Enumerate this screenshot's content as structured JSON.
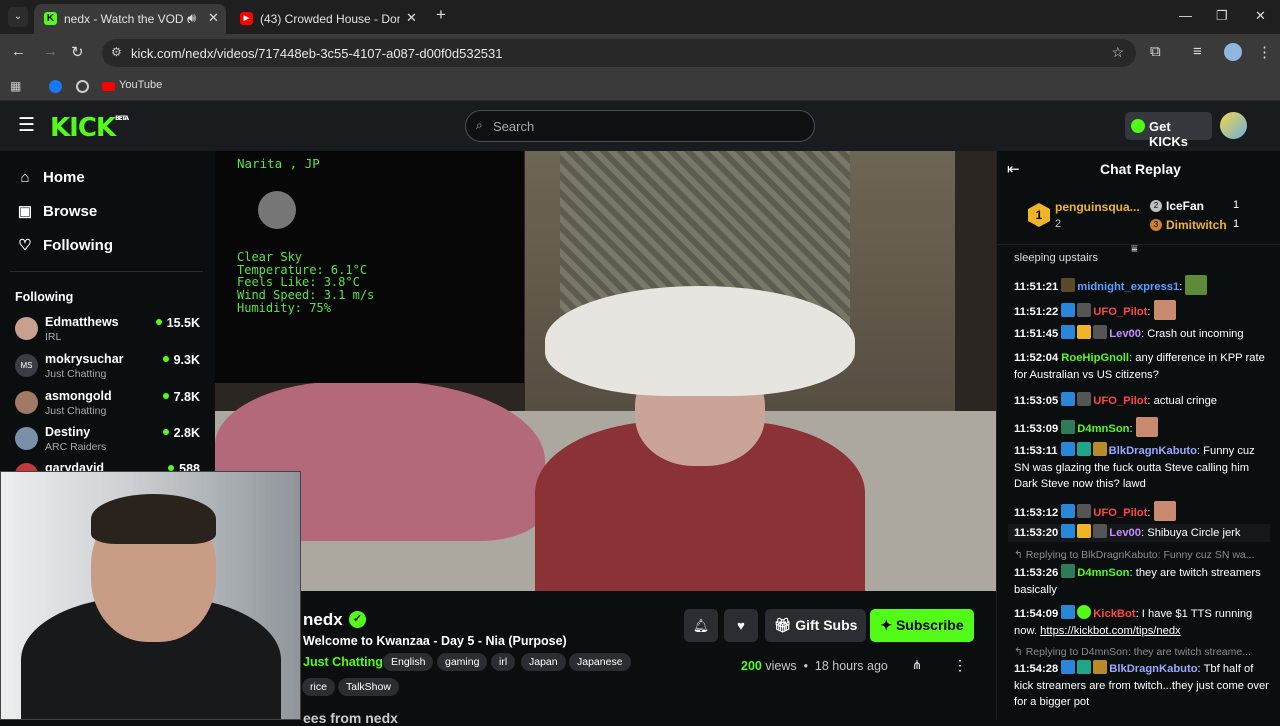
{
  "browser": {
    "tabs": [
      {
        "title": "nedx - Watch the VOD on Kick",
        "favicon": "K"
      },
      {
        "title": "(43) Crowded House - Don't Dream",
        "favicon": "▶"
      }
    ],
    "url": "kick.com/nedx/videos/717448eb-3c55-4107-a087-d00f0d532531",
    "bookmarks": [
      "YouTube"
    ]
  },
  "header": {
    "logo": "KICK",
    "logo_sup": "BETA",
    "search_placeholder": "Search",
    "get_kicks": "Get KICKs"
  },
  "sidebar": {
    "nav": [
      {
        "label": "Home",
        "icon": "home-icon"
      },
      {
        "label": "Browse",
        "icon": "browse-icon"
      },
      {
        "label": "Following",
        "icon": "heart-icon"
      }
    ],
    "following_title": "Following",
    "following": [
      {
        "name": "Edmatthews",
        "category": "IRL",
        "viewers": "15.5K",
        "color": "#c9a090"
      },
      {
        "name": "mokrysuchar",
        "category": "Just Chatting",
        "viewers": "9.3K",
        "color": "#3a3d44"
      },
      {
        "name": "asmongold",
        "category": "Just Chatting",
        "viewers": "7.8K",
        "color": "#a07a64"
      },
      {
        "name": "Destiny",
        "category": "ARC Raiders",
        "viewers": "2.8K",
        "color": "#7a8fa8"
      },
      {
        "name": "garydavid",
        "category": "",
        "viewers": "588",
        "color": "#c43a3a"
      }
    ]
  },
  "video_overlay": {
    "city": "Narita , JP",
    "weather": [
      "Clear Sky",
      "Temperature: 6.1°C",
      "Feels Like: 3.8°C",
      "Wind Speed: 3.1 m/s",
      "Humidity: 75%"
    ]
  },
  "stream": {
    "channel": "nedx",
    "title": "Welcome to Kwanzaa - Day 5 - Nia (Purpose)",
    "category": "Just Chatting",
    "tags": [
      "English",
      "gaming",
      "irl",
      "Japan",
      "Japanese",
      "rice",
      "TalkShow"
    ],
    "gift_subs": "Gift Subs",
    "subscribe": "Subscribe",
    "views": "200",
    "views_label": "views",
    "age": "18 hours ago",
    "more_from": "ees from nedx"
  },
  "chat": {
    "title": "Chat Replay",
    "leaderboard": [
      {
        "rank": "1",
        "name": "penguinsqua...",
        "count": "2"
      },
      {
        "rank": "2",
        "name": "IceFan",
        "count": "1"
      },
      {
        "rank": "3",
        "name": "Dimitwitch",
        "count": "1"
      }
    ],
    "partial_top": "sleeping upstairs",
    "messages": [
      {
        "time": "11:51:21",
        "user": "midnight_express1",
        "color": "#5aa0ff",
        "text": ""
      },
      {
        "time": "11:51:22",
        "user": "UFO_Pilot",
        "color": "#ff4747",
        "text": ""
      },
      {
        "time": "11:51:45",
        "user": "Lev00",
        "color": "#c98bff",
        "text": "Crash out incoming"
      },
      {
        "time": "11:52:04",
        "user": "RoeHipGnoll",
        "color": "#53fc18",
        "text": "any difference in KPP rate for Australian vs US citizens?"
      },
      {
        "time": "11:53:05",
        "user": "UFO_Pilot",
        "color": "#ff4747",
        "text": "actual cringe"
      },
      {
        "time": "11:53:09",
        "user": "D4mnSon",
        "color": "#53fc18",
        "text": ""
      },
      {
        "time": "11:53:11",
        "user": "BlkDragnKabuto",
        "color": "#9aa8ff",
        "text": "Funny cuz SN was glazing the fuck outta Steve calling him Dark Steve now this? lawd"
      },
      {
        "time": "11:53:12",
        "user": "UFO_Pilot",
        "color": "#ff4747",
        "text": ""
      },
      {
        "time": "11:53:20",
        "user": "Lev00",
        "color": "#c98bff",
        "text": "Shibuya Circle jerk"
      },
      {
        "time": "11:53:26",
        "user": "D4mnSon",
        "color": "#53fc18",
        "text": "they are twitch streamers basically",
        "reply": "Replying to BlkDragnKabuto: Funny cuz SN wa..."
      },
      {
        "time": "11:54:09",
        "user": "KickBot",
        "color": "#ff4747",
        "text": "I have $1 TTS running now.",
        "link": "https://kickbot.com/tips/nedx"
      },
      {
        "time": "11:54:28",
        "user": "BlkDragnKabuto",
        "color": "#9aa8ff",
        "text": "Tbf half of kick streamers are from twitch...they just come over for a bigger pot",
        "reply": "Replying to D4mnSon: they are twitch streame..."
      }
    ]
  }
}
